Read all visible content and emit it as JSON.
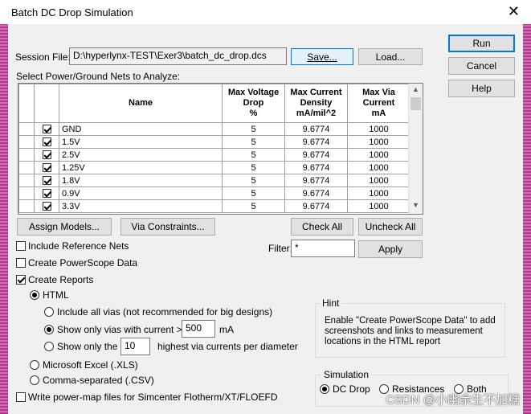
{
  "window": {
    "title": "Batch DC Drop Simulation",
    "close_glyph": "✕"
  },
  "session": {
    "label": "Session File:",
    "path": "D:\\hyperlynx-TEST\\Exer3\\batch_dc_drop.dcs",
    "save_label": "Save...",
    "load_label": "Load..."
  },
  "side_buttons": {
    "run": "Run",
    "cancel": "Cancel",
    "help": "Help"
  },
  "nets": {
    "section_label": "Select Power/Ground Nets to Analyze:",
    "columns": [
      "Name",
      "Max Voltage Drop %",
      "Max Current Density mA/mil^2",
      "Max Via Current mA"
    ],
    "column_lines": [
      [
        "Name"
      ],
      [
        "Max Voltage",
        "Drop",
        "%"
      ],
      [
        "Max Current",
        "Density",
        "mA/mil^2"
      ],
      [
        "Max Via",
        "Current",
        "mA"
      ]
    ],
    "rows": [
      {
        "name": "GND",
        "checked": true,
        "vdrop": "5",
        "density": "9.6774",
        "via": "1000"
      },
      {
        "name": "1.5V",
        "checked": true,
        "vdrop": "5",
        "density": "9.6774",
        "via": "1000"
      },
      {
        "name": "2.5V",
        "checked": true,
        "vdrop": "5",
        "density": "9.6774",
        "via": "1000"
      },
      {
        "name": "1.25V",
        "checked": true,
        "vdrop": "5",
        "density": "9.6774",
        "via": "1000"
      },
      {
        "name": "1.8V",
        "checked": true,
        "vdrop": "5",
        "density": "9.6774",
        "via": "1000"
      },
      {
        "name": "0.9V",
        "checked": true,
        "vdrop": "5",
        "density": "9.6774",
        "via": "1000"
      },
      {
        "name": "3.3V",
        "checked": true,
        "vdrop": "5",
        "density": "9.6774",
        "via": "1000"
      }
    ],
    "scroll_up": "▲",
    "scroll_down": "▼"
  },
  "table_buttons": {
    "assign_models": "Assign Models...",
    "via_constraints": "Via Constraints...",
    "check_all": "Check All",
    "uncheck_all": "Uncheck All"
  },
  "filter": {
    "label": "Filter:",
    "value": "*",
    "apply": "Apply"
  },
  "options": {
    "include_reference_nets": {
      "label": "Include Reference Nets",
      "checked": false
    },
    "create_powerscope": {
      "label": "Create PowerScope Data",
      "checked": false
    },
    "create_reports": {
      "label": "Create Reports",
      "checked": true
    },
    "html": {
      "label": "HTML",
      "selected": true
    },
    "include_all_vias": {
      "label": "Include all vias (not recommended for big designs)",
      "selected": false
    },
    "show_only_vias": {
      "label": "Show only vias with current >",
      "value": "500",
      "unit": "mA",
      "selected": true
    },
    "show_only_the": {
      "label": "Show only the",
      "value": "10",
      "suffix": "highest via currents per diameter",
      "selected": false
    },
    "excel": {
      "label": "Microsoft Excel (.XLS)",
      "selected": false
    },
    "csv": {
      "label": "Comma-separated (.CSV)",
      "selected": false
    },
    "power_map": {
      "label": "Write power-map files for Simcenter Flotherm/XT/FLOEFD",
      "checked": false
    }
  },
  "hint": {
    "title": "Hint",
    "lines": [
      "Enable \"Create PowerScope Data\" to add",
      "screenshots and links to measurement",
      "locations in the HTML report"
    ]
  },
  "simulation": {
    "title": "Simulation",
    "dc_drop": "DC Drop",
    "resistances": "Resistances",
    "both": "Both",
    "selected": "DC Drop"
  },
  "watermark": "CSDN @小幽余生不加糖"
}
